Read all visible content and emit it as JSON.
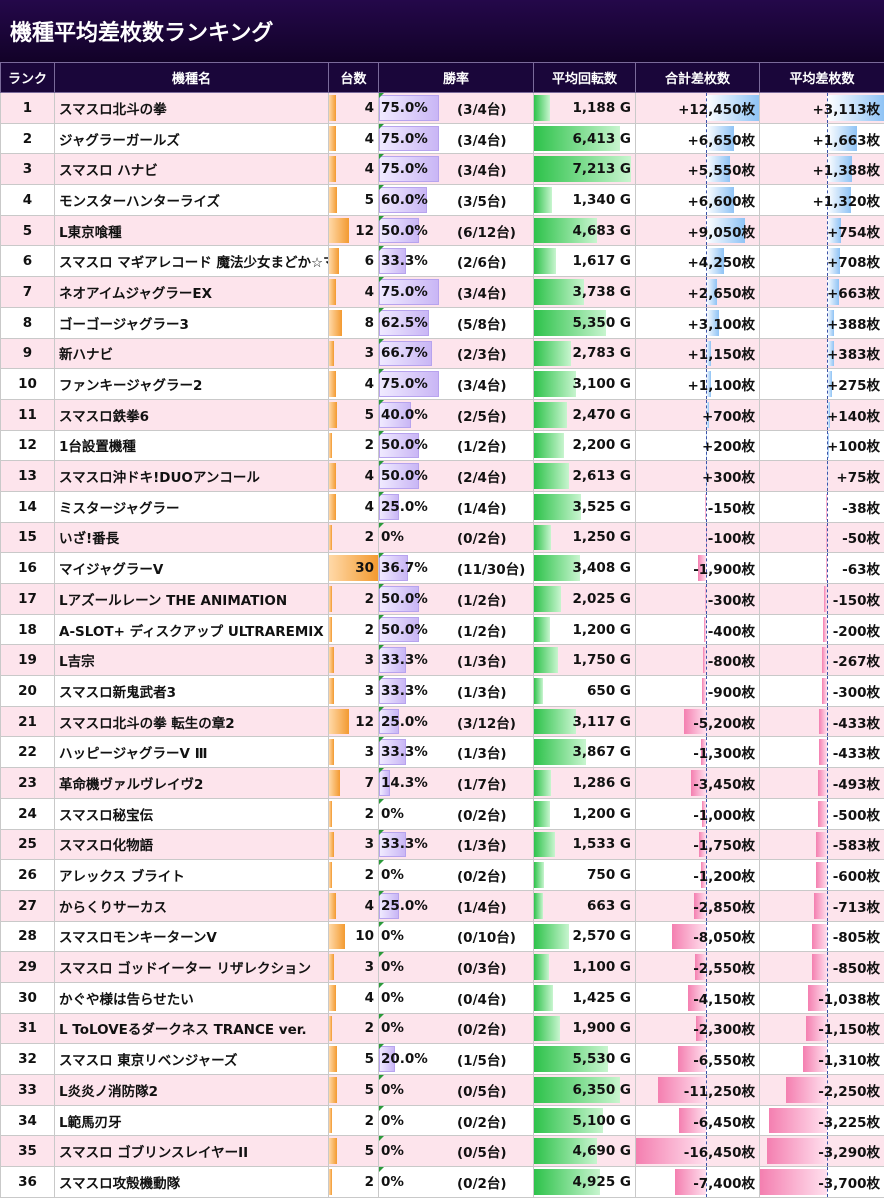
{
  "title": "機種平均差枚数ランキング",
  "headers": [
    "ランク",
    "機種名",
    "台数",
    "勝率",
    "平均回転数",
    "合計差枚数",
    "平均差枚数"
  ],
  "colors": {
    "header_bg": "#1a063a",
    "odd_row": "#fde4ec",
    "units_bar": "#f39a30",
    "win_bar": "#c9b6f5",
    "spins_bar": "#2dc24a",
    "pos_bar": "#8fc3f5",
    "neg_bar": "#f47fb0"
  },
  "rows": [
    {
      "rank": "1",
      "name": "スマスロ北斗の拳",
      "units": "4",
      "winrate": "75.0%",
      "winfrac": "(3/4台)",
      "spins": "1,188 G",
      "total": "+12,450枚",
      "avg": "+3,113枚"
    },
    {
      "rank": "2",
      "name": "ジャグラーガールズ",
      "units": "4",
      "winrate": "75.0%",
      "winfrac": "(3/4台)",
      "spins": "6,413 G",
      "total": "+6,650枚",
      "avg": "+1,663枚"
    },
    {
      "rank": "3",
      "name": "スマスロ ハナビ",
      "units": "4",
      "winrate": "75.0%",
      "winfrac": "(3/4台)",
      "spins": "7,213 G",
      "total": "+5,550枚",
      "avg": "+1,388枚"
    },
    {
      "rank": "4",
      "name": "モンスターハンターライズ",
      "units": "5",
      "winrate": "60.0%",
      "winfrac": "(3/5台)",
      "spins": "1,340 G",
      "total": "+6,600枚",
      "avg": "+1,320枚"
    },
    {
      "rank": "5",
      "name": "L東京喰種",
      "units": "12",
      "winrate": "50.0%",
      "winfrac": "(6/12台)",
      "spins": "4,683 G",
      "total": "+9,050枚",
      "avg": "+754枚"
    },
    {
      "rank": "6",
      "name": "スマスロ マギアレコード 魔法少女まどか☆マギカ外伝",
      "units": "6",
      "winrate": "33.3%",
      "winfrac": "(2/6台)",
      "spins": "1,617 G",
      "total": "+4,250枚",
      "avg": "+708枚"
    },
    {
      "rank": "7",
      "name": "ネオアイムジャグラーEX",
      "units": "4",
      "winrate": "75.0%",
      "winfrac": "(3/4台)",
      "spins": "3,738 G",
      "total": "+2,650枚",
      "avg": "+663枚"
    },
    {
      "rank": "8",
      "name": "ゴーゴージャグラー3",
      "units": "8",
      "winrate": "62.5%",
      "winfrac": "(5/8台)",
      "spins": "5,350 G",
      "total": "+3,100枚",
      "avg": "+388枚"
    },
    {
      "rank": "9",
      "name": "新ハナビ",
      "units": "3",
      "winrate": "66.7%",
      "winfrac": "(2/3台)",
      "spins": "2,783 G",
      "total": "+1,150枚",
      "avg": "+383枚"
    },
    {
      "rank": "10",
      "name": "ファンキージャグラー2",
      "units": "4",
      "winrate": "75.0%",
      "winfrac": "(3/4台)",
      "spins": "3,100 G",
      "total": "+1,100枚",
      "avg": "+275枚"
    },
    {
      "rank": "11",
      "name": "スマスロ鉄拳6",
      "units": "5",
      "winrate": "40.0%",
      "winfrac": "(2/5台)",
      "spins": "2,470 G",
      "total": "+700枚",
      "avg": "+140枚"
    },
    {
      "rank": "12",
      "name": "1台設置機種",
      "units": "2",
      "winrate": "50.0%",
      "winfrac": "(1/2台)",
      "spins": "2,200 G",
      "total": "+200枚",
      "avg": "+100枚"
    },
    {
      "rank": "13",
      "name": "スマスロ沖ドキ!DUOアンコール",
      "units": "4",
      "winrate": "50.0%",
      "winfrac": "(2/4台)",
      "spins": "2,613 G",
      "total": "+300枚",
      "avg": "+75枚"
    },
    {
      "rank": "14",
      "name": "ミスタージャグラー",
      "units": "4",
      "winrate": "25.0%",
      "winfrac": "(1/4台)",
      "spins": "3,525 G",
      "total": "-150枚",
      "avg": "-38枚"
    },
    {
      "rank": "15",
      "name": "いざ!番長",
      "units": "2",
      "winrate": "0%",
      "winfrac": "(0/2台)",
      "spins": "1,250 G",
      "total": "-100枚",
      "avg": "-50枚"
    },
    {
      "rank": "16",
      "name": "マイジャグラーV",
      "units": "30",
      "winrate": "36.7%",
      "winfrac": "(11/30台)",
      "spins": "3,408 G",
      "total": "-1,900枚",
      "avg": "-63枚"
    },
    {
      "rank": "17",
      "name": "Lアズールレーン THE ANIMATION",
      "units": "2",
      "winrate": "50.0%",
      "winfrac": "(1/2台)",
      "spins": "2,025 G",
      "total": "-300枚",
      "avg": "-150枚"
    },
    {
      "rank": "18",
      "name": "A-SLOT+ ディスクアップ ULTRAREMIX",
      "units": "2",
      "winrate": "50.0%",
      "winfrac": "(1/2台)",
      "spins": "1,200 G",
      "total": "-400枚",
      "avg": "-200枚"
    },
    {
      "rank": "19",
      "name": "L吉宗",
      "units": "3",
      "winrate": "33.3%",
      "winfrac": "(1/3台)",
      "spins": "1,750 G",
      "total": "-800枚",
      "avg": "-267枚"
    },
    {
      "rank": "20",
      "name": "スマスロ新鬼武者3",
      "units": "3",
      "winrate": "33.3%",
      "winfrac": "(1/3台)",
      "spins": "650 G",
      "total": "-900枚",
      "avg": "-300枚"
    },
    {
      "rank": "21",
      "name": "スマスロ北斗の拳 転生の章2",
      "units": "12",
      "winrate": "25.0%",
      "winfrac": "(3/12台)",
      "spins": "3,117 G",
      "total": "-5,200枚",
      "avg": "-433枚"
    },
    {
      "rank": "22",
      "name": "ハッピージャグラーV Ⅲ",
      "units": "3",
      "winrate": "33.3%",
      "winfrac": "(1/3台)",
      "spins": "3,867 G",
      "total": "-1,300枚",
      "avg": "-433枚"
    },
    {
      "rank": "23",
      "name": "革命機ヴァルヴレイヴ2",
      "units": "7",
      "winrate": "14.3%",
      "winfrac": "(1/7台)",
      "spins": "1,286 G",
      "total": "-3,450枚",
      "avg": "-493枚"
    },
    {
      "rank": "24",
      "name": "スマスロ秘宝伝",
      "units": "2",
      "winrate": "0%",
      "winfrac": "(0/2台)",
      "spins": "1,200 G",
      "total": "-1,000枚",
      "avg": "-500枚"
    },
    {
      "rank": "25",
      "name": "スマスロ化物語",
      "units": "3",
      "winrate": "33.3%",
      "winfrac": "(1/3台)",
      "spins": "1,533 G",
      "total": "-1,750枚",
      "avg": "-583枚"
    },
    {
      "rank": "26",
      "name": "アレックス ブライト",
      "units": "2",
      "winrate": "0%",
      "winfrac": "(0/2台)",
      "spins": "750 G",
      "total": "-1,200枚",
      "avg": "-600枚"
    },
    {
      "rank": "27",
      "name": "からくりサーカス",
      "units": "4",
      "winrate": "25.0%",
      "winfrac": "(1/4台)",
      "spins": "663 G",
      "total": "-2,850枚",
      "avg": "-713枚"
    },
    {
      "rank": "28",
      "name": "スマスロモンキーターンV",
      "units": "10",
      "winrate": "0%",
      "winfrac": "(0/10台)",
      "spins": "2,570 G",
      "total": "-8,050枚",
      "avg": "-805枚"
    },
    {
      "rank": "29",
      "name": "スマスロ ゴッドイーター リザレクション",
      "units": "3",
      "winrate": "0%",
      "winfrac": "(0/3台)",
      "spins": "1,100 G",
      "total": "-2,550枚",
      "avg": "-850枚"
    },
    {
      "rank": "30",
      "name": "かぐや様は告らせたい",
      "units": "4",
      "winrate": "0%",
      "winfrac": "(0/4台)",
      "spins": "1,425 G",
      "total": "-4,150枚",
      "avg": "-1,038枚"
    },
    {
      "rank": "31",
      "name": "L ToLOVEるダークネス TRANCE ver.",
      "units": "2",
      "winrate": "0%",
      "winfrac": "(0/2台)",
      "spins": "1,900 G",
      "total": "-2,300枚",
      "avg": "-1,150枚"
    },
    {
      "rank": "32",
      "name": "スマスロ 東京リベンジャーズ",
      "units": "5",
      "winrate": "20.0%",
      "winfrac": "(1/5台)",
      "spins": "5,530 G",
      "total": "-6,550枚",
      "avg": "-1,310枚"
    },
    {
      "rank": "33",
      "name": "L炎炎ノ消防隊2",
      "units": "5",
      "winrate": "0%",
      "winfrac": "(0/5台)",
      "spins": "6,350 G",
      "total": "-11,250枚",
      "avg": "-2,250枚"
    },
    {
      "rank": "34",
      "name": "L範馬刃牙",
      "units": "2",
      "winrate": "0%",
      "winfrac": "(0/2台)",
      "spins": "5,100 G",
      "total": "-6,450枚",
      "avg": "-3,225枚"
    },
    {
      "rank": "35",
      "name": "スマスロ ゴブリンスレイヤーII",
      "units": "5",
      "winrate": "0%",
      "winfrac": "(0/5台)",
      "spins": "4,690 G",
      "total": "-16,450枚",
      "avg": "-3,290枚"
    },
    {
      "rank": "36",
      "name": "スマスロ攻殻機動隊",
      "units": "2",
      "winrate": "0%",
      "winfrac": "(0/2台)",
      "spins": "4,925 G",
      "total": "-7,400枚",
      "avg": "-3,700枚"
    }
  ]
}
